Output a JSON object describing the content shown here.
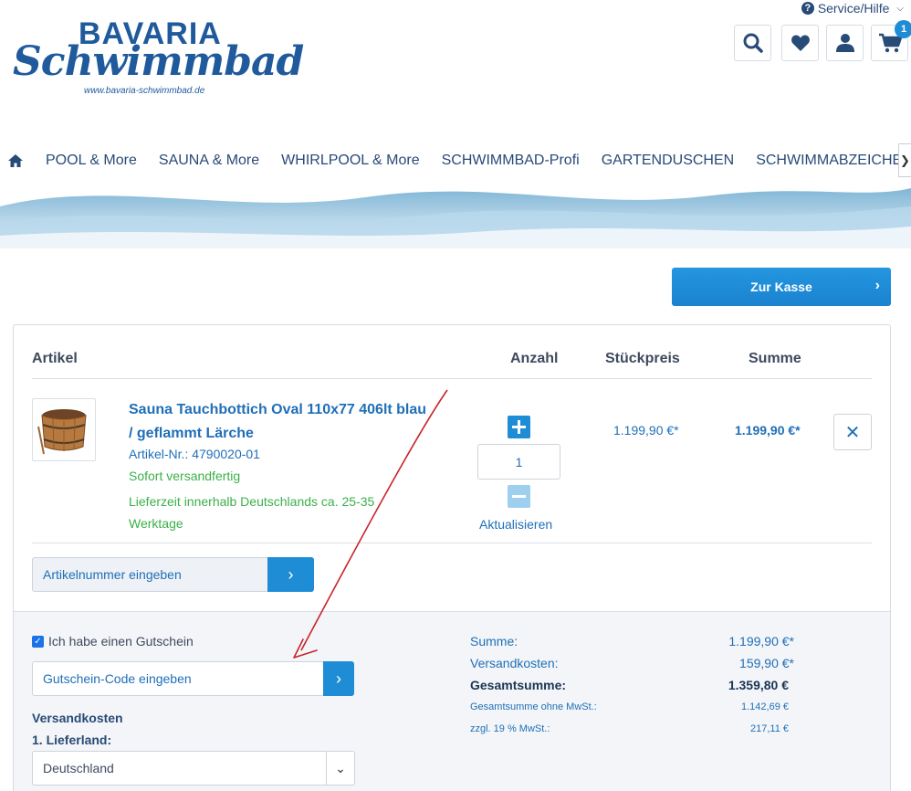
{
  "header": {
    "logo": {
      "top": "BAVARIA",
      "script": "Schwimmbad",
      "url": "www.bavaria-schwimmbad.de"
    },
    "service_label": "Service/Hilfe",
    "cart_count": "1",
    "icons": [
      "search-icon",
      "heart-icon",
      "user-icon",
      "cart-icon"
    ]
  },
  "nav": {
    "items": [
      "POOL & More",
      "SAUNA & More",
      "WHIRLPOOL & More",
      "SCHWIMMBAD-Profi",
      "GARTENDUSCHEN",
      "SCHWIMMABZEICHEN"
    ]
  },
  "checkout_label": "Zur Kasse",
  "cart": {
    "headers": {
      "article": "Artikel",
      "quantity": "Anzahl",
      "unit_price": "Stückpreis",
      "total": "Summe"
    },
    "item": {
      "name": "Sauna Tauchbottich Oval 110x77 406lt blau / geflammt Lärche",
      "number": "Artikel-Nr.: 4790020-01",
      "availability": "Sofort versandfertig",
      "delivery": "Lieferzeit innerhalb Deutschlands ca. 25-35 Werktage",
      "quantity": "1",
      "update_label": "Aktualisieren",
      "unit_price": "1.199,90 €*",
      "total_price": "1.199,90 €*"
    },
    "article_input_placeholder": "Artikelnummer eingeben"
  },
  "voucher": {
    "checkbox_label": "Ich habe einen Gutschein",
    "checked": true,
    "input_placeholder": "Gutschein-Code eingeben"
  },
  "shipping": {
    "title": "Versandkosten",
    "country_label": "1. Lieferland:",
    "country": "Deutschland"
  },
  "summary": {
    "subtotal_label": "Summe:",
    "subtotal": "1.199,90 €*",
    "shipping_label": "Versandkosten:",
    "shipping": "159,90 €*",
    "grand_total_label": "Gesamtsumme:",
    "grand_total": "1.359,80 €",
    "net_label": "Gesamtsumme ohne MwSt.:",
    "net": "1.142,69 €",
    "vat_label": "zzgl. 19 % MwSt.:",
    "vat": "217,11 €"
  },
  "colors": {
    "brand": "#1f5a9c",
    "accent": "#1f8dd6",
    "link": "#1f6fb8",
    "stock_green": "#3cb04a"
  }
}
